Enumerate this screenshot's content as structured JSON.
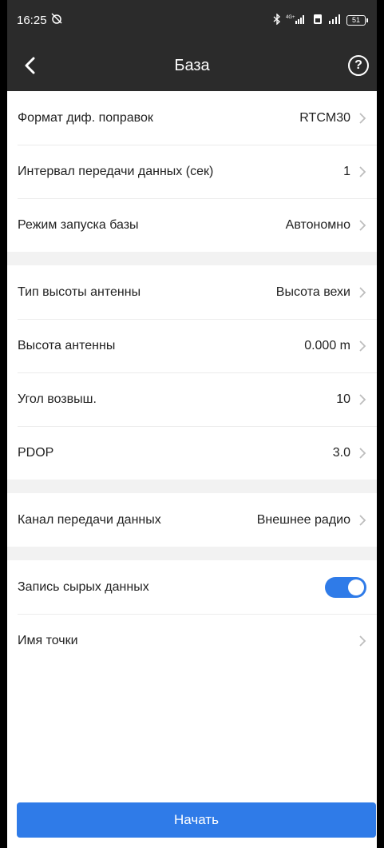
{
  "status_bar": {
    "time": "16:25",
    "alarm_icon": "alarm-off-icon",
    "network": "4G+",
    "battery": "51"
  },
  "header": {
    "title": "База",
    "back_icon": "back-arrow-icon",
    "help_icon": "help-icon",
    "help_glyph": "?"
  },
  "group1": [
    {
      "label": "Формат диф. поправок",
      "value": "RTCM30"
    },
    {
      "label": "Интервал передачи данных (сек)",
      "value": "1"
    },
    {
      "label": "Режим запуска базы",
      "value": "Автономно"
    }
  ],
  "group2": [
    {
      "label": "Тип высоты антенны",
      "value": "Высота вехи"
    },
    {
      "label": "Высота антенны",
      "value": "0.000 m"
    },
    {
      "label": "Угол возвыш.",
      "value": "10"
    },
    {
      "label": "PDOP",
      "value": "3.0"
    }
  ],
  "group3": [
    {
      "label": "Канал передачи данных",
      "value": "Внешнее радио"
    }
  ],
  "group4": {
    "raw_record": {
      "label": "Запись сырых данных",
      "enabled": true
    },
    "point_name": {
      "label": "Имя точки",
      "value": ""
    }
  },
  "start_button": {
    "label": "Начать"
  },
  "colors": {
    "accent": "#2f7be8",
    "bar": "#2b2b2b",
    "gap": "#f2f2f2"
  }
}
